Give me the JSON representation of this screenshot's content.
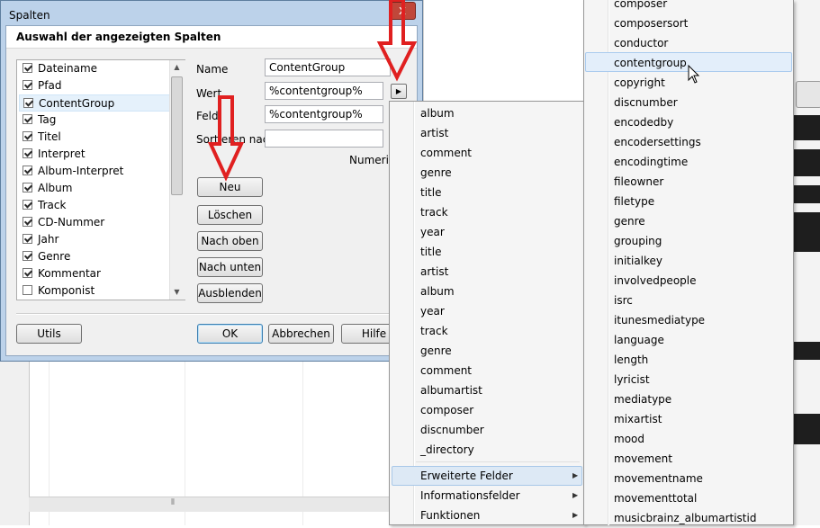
{
  "dialog": {
    "title": "Spalten",
    "close_glyph": "x",
    "header": "Auswahl der angezeigten Spalten"
  },
  "columns_list": [
    {
      "label": "Dateiname",
      "checked": true
    },
    {
      "label": "Pfad",
      "checked": true
    },
    {
      "label": "ContentGroup",
      "checked": true,
      "selected": true
    },
    {
      "label": "Tag",
      "checked": true
    },
    {
      "label": "Titel",
      "checked": true
    },
    {
      "label": "Interpret",
      "checked": true
    },
    {
      "label": "Album-Interpret",
      "checked": true
    },
    {
      "label": "Album",
      "checked": true
    },
    {
      "label": "Track",
      "checked": true
    },
    {
      "label": "CD-Nummer",
      "checked": true
    },
    {
      "label": "Jahr",
      "checked": true
    },
    {
      "label": "Genre",
      "checked": true
    },
    {
      "label": "Kommentar",
      "checked": true
    },
    {
      "label": "Komponist",
      "checked": false
    }
  ],
  "form": {
    "name_label": "Name",
    "name_value": "ContentGroup",
    "wert_label": "Wert",
    "wert_value": "%contentgroup%",
    "feld_label": "Feld:",
    "feld_value": "%contentgroup%",
    "sort_label": "Sortieren nach",
    "sort_value": "",
    "numeric_label": "Numerisc"
  },
  "buttons": {
    "neu": "Neu",
    "loeschen": "Löschen",
    "nach_oben": "Nach oben",
    "nach_unten": "Nach unten",
    "ausblenden": "Ausblenden",
    "utils": "Utils",
    "ok": "OK",
    "abbrechen": "Abbrechen",
    "hilfe": "Hilfe"
  },
  "menu_main": {
    "items": [
      "album",
      "artist",
      "comment",
      "genre",
      "title",
      "track",
      "year",
      "title",
      "artist",
      "album",
      "year",
      "track",
      "genre",
      "comment",
      "albumartist",
      "composer",
      "discnumber",
      "_directory"
    ],
    "submenus": [
      "Erweiterte Felder",
      "Informationsfelder",
      "Funktionen"
    ]
  },
  "menu_extended": {
    "items": [
      "composer",
      "composersort",
      "conductor",
      "contentgroup",
      "copyright",
      "discnumber",
      "encodedby",
      "encodersettings",
      "encodingtime",
      "fileowner",
      "filetype",
      "genre",
      "grouping",
      "initialkey",
      "involvedpeople",
      "isrc",
      "itunesmediatype",
      "language",
      "length",
      "lyricist",
      "mediatype",
      "mixartist",
      "mood",
      "movement",
      "movementname",
      "movementtotal",
      "musicbrainz_albumartistid"
    ],
    "highlighted": "contentgroup"
  },
  "colors": {
    "annotation_red": "#e02020",
    "menu_hover": "#dde9f5",
    "title_bar": "#bcd2ea"
  },
  "icons": {
    "scroll_up": "▲",
    "scroll_down": "▼",
    "submenu": "▶",
    "h_scroll": "⦀"
  }
}
